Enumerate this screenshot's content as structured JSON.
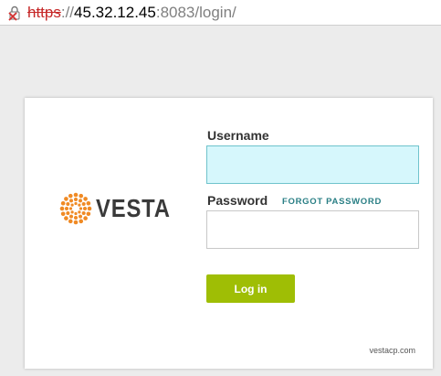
{
  "browser": {
    "url_scheme": "https",
    "url_separator": "://",
    "url_host": "45.32.12.45",
    "url_path": ":8083/login/",
    "security_icon": "broken-lock-icon",
    "scheme_color": "#c62828"
  },
  "login": {
    "logo_text": "VESTA",
    "logo_icon": "vesta-ring-logo-icon",
    "logo_color": "#f08a24",
    "username_label": "Username",
    "username_value": "",
    "password_label": "Password",
    "password_value": "",
    "forgot_link": "FORGOT PASSWORD",
    "login_button": "Log in",
    "button_color": "#9fbe05",
    "footer": "vestacp.com"
  }
}
